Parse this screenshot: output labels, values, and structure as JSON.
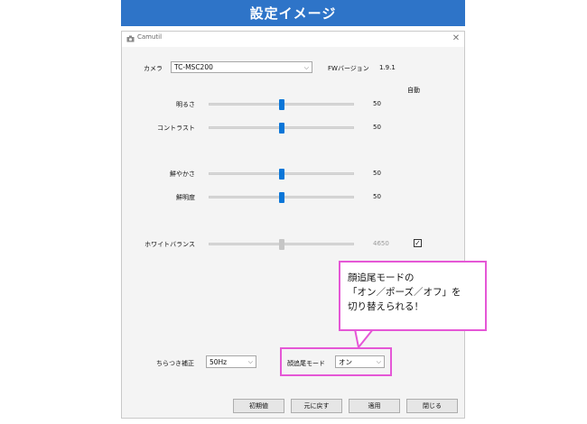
{
  "banner": {
    "title": "設定イメージ"
  },
  "window": {
    "title": "Camutil",
    "close_glyph": "✕"
  },
  "camera": {
    "label": "カメラ",
    "selected": "TC-MSC200",
    "fw_label": "FWバージョン",
    "fw_version": "1.9.1"
  },
  "auto_header": "自動",
  "sliders": [
    {
      "label": "明るさ",
      "value": "50",
      "level": 0.5,
      "enabled": true
    },
    {
      "label": "コントラスト",
      "value": "50",
      "level": 0.5,
      "enabled": true
    },
    {
      "label": "鮮やかさ",
      "value": "50",
      "level": 0.5,
      "enabled": true
    },
    {
      "label": "鮮明度",
      "value": "50",
      "level": 0.5,
      "enabled": true
    },
    {
      "label": "ホワイトバランス",
      "value": "4650",
      "level": 0.5,
      "enabled": false,
      "auto_checked": true
    }
  ],
  "flicker": {
    "label": "ちらつき補正",
    "selected": "50Hz"
  },
  "tracking": {
    "label": "顔追尾モード",
    "selected": "オン"
  },
  "buttons": {
    "reset": "初期値",
    "revert": "元に戻す",
    "apply": "適用",
    "close": "閉じる"
  },
  "callout": {
    "line1": "顔追尾モードの",
    "line2": "「オン／ポーズ／オフ」を",
    "line3": "切り替えられる！"
  },
  "colors": {
    "accent": "#0a76d8",
    "banner": "#2e74c8",
    "highlight": "#e557d6"
  }
}
